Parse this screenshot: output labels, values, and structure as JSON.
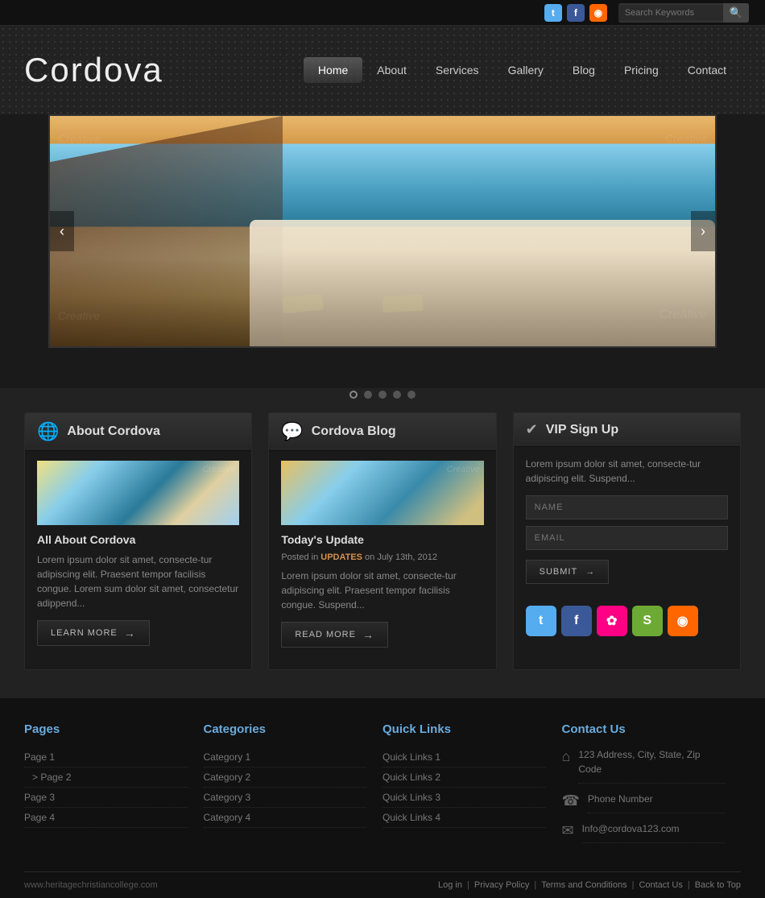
{
  "topbar": {
    "search_placeholder": "Search Keywords",
    "search_button": "🔍"
  },
  "header": {
    "logo": "Cordova",
    "nav": [
      {
        "label": "Home",
        "active": true
      },
      {
        "label": "About",
        "active": false
      },
      {
        "label": "Services",
        "active": false
      },
      {
        "label": "Gallery",
        "active": false
      },
      {
        "label": "Blog",
        "active": false
      },
      {
        "label": "Pricing",
        "active": false
      },
      {
        "label": "Contact",
        "active": false
      }
    ]
  },
  "slider": {
    "prev": "‹",
    "next": "›",
    "dots": [
      true,
      false,
      false,
      false,
      false
    ]
  },
  "about_card": {
    "title": "About Cordova",
    "post_title": "All About Cordova",
    "text": "Lorem ipsum dolor sit amet, consecte-tur adipiscing elit. Praesent tempor facilisis congue. Lorem sum dolor sit amet, consectetur adippend...",
    "btn_label": "LEARN MORE"
  },
  "blog_card": {
    "title": "Cordova Blog",
    "post_title": "Today's Update",
    "meta_prefix": "Posted in",
    "meta_tag": "UPDATES",
    "meta_suffix": "on July 13th, 2012",
    "text": "Lorem ipsum dolor sit amet, consecte-tur adipiscing elit. Praesent tempor facilisis congue. Suspend...",
    "btn_label": "READ MORE"
  },
  "vip_card": {
    "title": "VIP Sign Up",
    "description": "Lorem ipsum dolor sit amet, consecte-tur adipiscing elit. Suspend...",
    "name_placeholder": "NAME",
    "email_placeholder": "EMAIL",
    "submit_label": "SUBMIT"
  },
  "footer": {
    "pages_title": "Pages",
    "pages": [
      {
        "label": "Page 1",
        "indent": false
      },
      {
        "label": ">  Page 2",
        "indent": false
      },
      {
        "label": "Page 3",
        "indent": false
      },
      {
        "label": "Page 4",
        "indent": false
      }
    ],
    "categories_title": "Categories",
    "categories": [
      {
        "label": "Category 1"
      },
      {
        "label": "Category 2"
      },
      {
        "label": "Category 3"
      },
      {
        "label": "Category 4"
      }
    ],
    "quicklinks_title": "Quick Links",
    "quicklinks": [
      {
        "label": "Quick Links 1"
      },
      {
        "label": "Quick Links 2"
      },
      {
        "label": "Quick Links 3"
      },
      {
        "label": "Quick Links 4"
      }
    ],
    "contact_title": "Contact Us",
    "contact_address": "123 Address, City, State, Zip Code",
    "contact_phone": "Phone Number",
    "contact_email": "Info@cordova123.com",
    "bottom_url": "www.heritagechristiancollege.com",
    "bottom_links": [
      "Log in",
      "Privacy Policy",
      "Terms and Conditions",
      "Contact Us",
      "Back to Top"
    ]
  }
}
